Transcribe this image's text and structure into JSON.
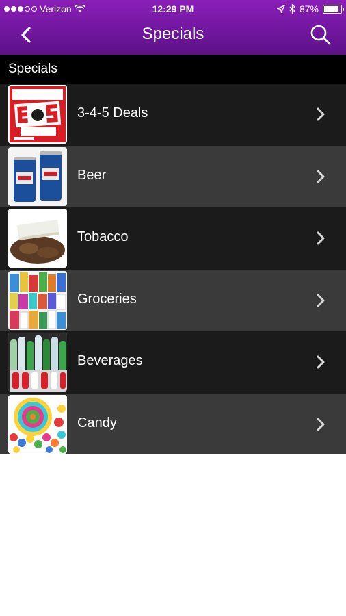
{
  "status_bar": {
    "carrier": "Verizon",
    "time": "12:29 PM",
    "battery": "87%",
    "battery_level": 0.87
  },
  "nav": {
    "title": "Specials",
    "back_icon": "chevron-left-icon",
    "search_icon": "search-icon"
  },
  "section": {
    "title": "Specials"
  },
  "items": [
    {
      "label": "3-4-5 Deals"
    },
    {
      "label": "Beer"
    },
    {
      "label": "Tobacco"
    },
    {
      "label": "Groceries"
    },
    {
      "label": "Beverages"
    },
    {
      "label": "Candy"
    }
  ],
  "colors": {
    "header": "#6f169c",
    "row_dark": "#1b1b1b",
    "row_light": "#3a3a3a"
  }
}
